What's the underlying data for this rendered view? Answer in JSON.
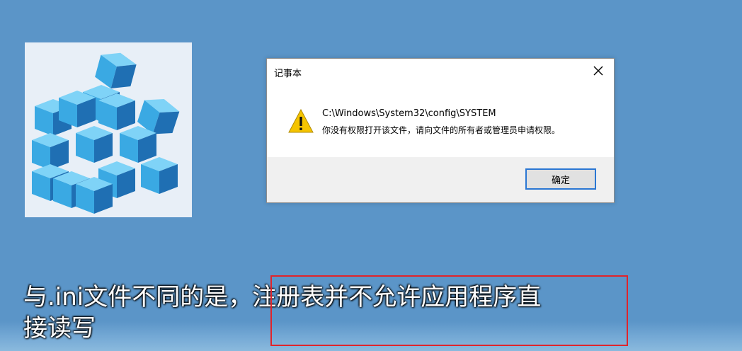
{
  "dialog": {
    "title": "记事本",
    "path": "C:\\Windows\\System32\\config\\SYSTEM",
    "message": "你没有权限打开该文件，请向文件的所有者或管理员申请权限。",
    "ok_label": "确定",
    "close_glyph": "✕"
  },
  "subtitle": {
    "line1": "与.ini文件不同的是，注册表并不允许应用程序直",
    "line2": "接读写"
  },
  "colors": {
    "background": "#5b95c8",
    "highlight": "#e0242b",
    "ok_border": "#2b77d3",
    "warning": "#f5c400"
  },
  "icons": {
    "registry": "registry-editor-icon",
    "warning": "warning-icon",
    "close": "close-icon"
  }
}
